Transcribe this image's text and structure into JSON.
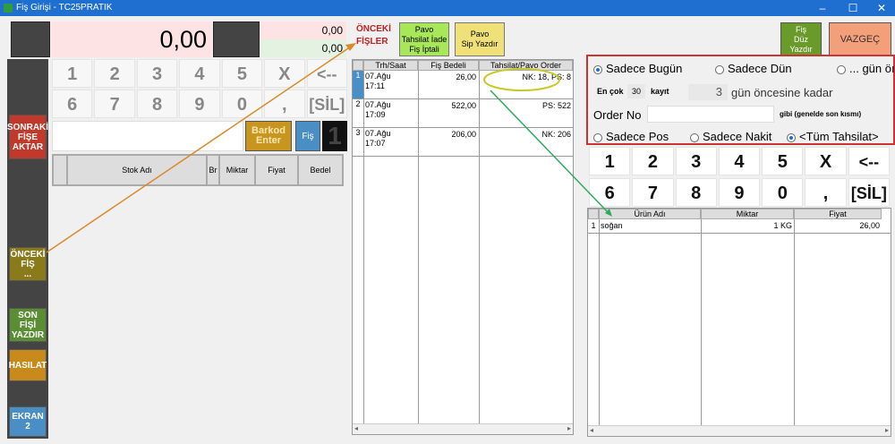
{
  "window": {
    "title": "Fiş Girişi - TC25PRATIK",
    "min": "–",
    "max": "☐",
    "close": "✕"
  },
  "display": {
    "total": "0,00",
    "sub1": "0,00",
    "sub2": "0,00"
  },
  "keypad_left": {
    "row1": [
      "1",
      "2",
      "3",
      "4",
      "5",
      "X",
      "<--"
    ],
    "row2": [
      "6",
      "7",
      "8",
      "9",
      "0",
      ",",
      "[SİL]"
    ]
  },
  "barcode_label": "Barkod\nEnter",
  "fis_label": "Fiş",
  "fis_count": "1",
  "left_table": {
    "headers": [
      "Stok Adı",
      "Br",
      "Miktar",
      "Fiyat",
      "Bedel"
    ]
  },
  "side_buttons": {
    "sonraki": "SONRAKİ\nFİŞE\nAKTAR",
    "onceki": "ÖNCEKİ\nFİŞ\n...",
    "son_fis": "SON\nFİŞİ\nYAZDIR",
    "hasilat": "HASILAT",
    "ekran": "EKRAN\n2"
  },
  "onceki_fisler": {
    "line1": "ÖNCEKİ",
    "line2": "FİŞLER"
  },
  "pavo_iade": "Pavo\nTahsilat İade\nFiş İptali",
  "pavo_sip": "Pavo\nSip Yazdır",
  "fis_duz_yazdir": "Fiş\nDüz\nYazdır",
  "vazgec": "VAZGEÇ",
  "receipts": {
    "headers": [
      "Trh/Saat",
      "Fiş Bedeli",
      "Tahsilat/Pavo Order"
    ],
    "rows": [
      {
        "no": "1",
        "date": "07.Ağu",
        "time": "17:11",
        "amount": "26,00",
        "payment": "NK: 18, PS: 8"
      },
      {
        "no": "2",
        "date": "07.Ağu",
        "time": "17:09",
        "amount": "522,00",
        "payment": "PS: 522"
      },
      {
        "no": "3",
        "date": "07.Ağu",
        "time": "17:07",
        "amount": "206,00",
        "payment": "NK: 206"
      }
    ]
  },
  "filters": {
    "today": "Sadece Bugün",
    "yesterday": "Sadece Dün",
    "days_ago": "... gün öı",
    "max_label": "En çok",
    "max_value": "30",
    "record_label": "kayıt",
    "days_value": "3",
    "days_until": "gün öncesine kadar",
    "order_label": "Order No",
    "order_hint": "gibi (genelde son kısmı)",
    "pos": "Sadece Pos",
    "cash": "Sadece Nakit",
    "all": "<Tüm Tahsilat>"
  },
  "keypad_right": {
    "row1": [
      "1",
      "2",
      "3",
      "4",
      "5",
      "X",
      "<--"
    ],
    "row2": [
      "6",
      "7",
      "8",
      "9",
      "0",
      ",",
      "[SİL]"
    ]
  },
  "products": {
    "headers": [
      "Ürün Adı",
      "Miktar",
      "Fiyat"
    ],
    "rows": [
      {
        "no": "1",
        "name": "soğan",
        "qty": "1 KG",
        "price": "26,00"
      }
    ]
  },
  "colors": {
    "orange_arrow": "#d98a2b",
    "green_arrow": "#2faa5a",
    "highlight": "#cc3333",
    "ellipse": "#c8c82a"
  }
}
